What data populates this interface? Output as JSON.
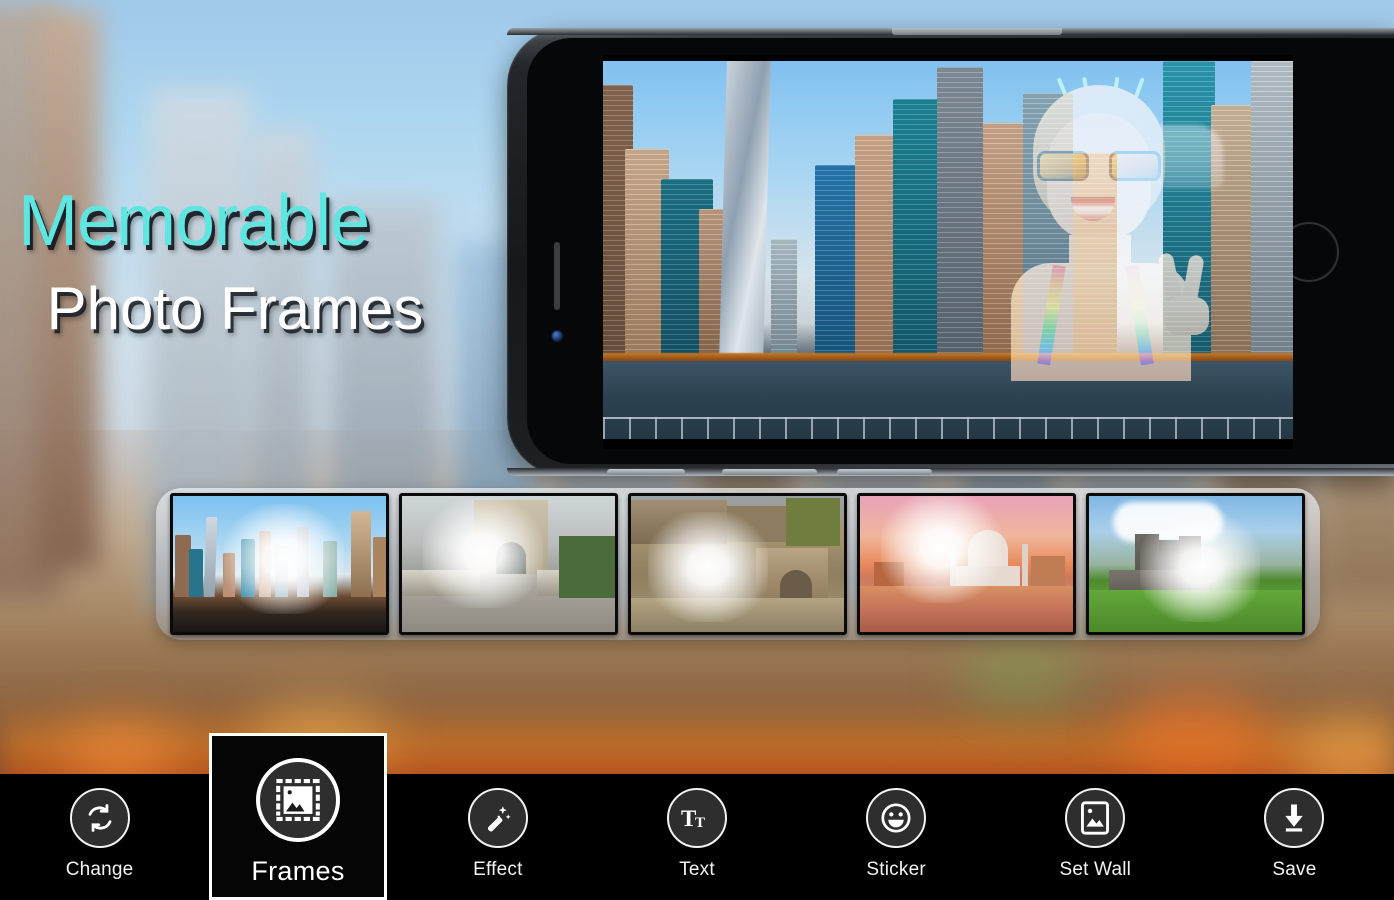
{
  "app": {
    "title_line1": "Memorable",
    "title_line2": "Photo Frames",
    "title_color_line1": "#5fe6e0",
    "title_color_line2": "#ffffff",
    "background": "blurred-city-skyline"
  },
  "preview": {
    "device": "smartphone-landscape",
    "screen_content": "dubai-marina-skyline-with-woman-portrait-overlay",
    "home_button": "home-button",
    "earpiece": "earpiece-speaker",
    "front_camera": "front-camera"
  },
  "frames_tray": {
    "selected_index": 0,
    "items": [
      {
        "id": "frame-1",
        "label": "Dubai Marina",
        "selected": true
      },
      {
        "id": "frame-2",
        "label": "Stone Bridge Gate",
        "selected": false
      },
      {
        "id": "frame-3",
        "label": "Roman Forum Ruins",
        "selected": false
      },
      {
        "id": "frame-4",
        "label": "Taj Mahal Sunset",
        "selected": false
      },
      {
        "id": "frame-5",
        "label": "Castle on Green",
        "selected": false
      }
    ]
  },
  "toolbar": {
    "items": [
      {
        "label": "Change",
        "icon": "refresh-icon",
        "selected": false
      },
      {
        "label": "Frames",
        "icon": "frames-icon",
        "selected": true
      },
      {
        "label": "Effect",
        "icon": "magic-wand-icon",
        "selected": false
      },
      {
        "label": "Text",
        "icon": "text-icon",
        "selected": false
      },
      {
        "label": "Sticker",
        "icon": "smiley-icon",
        "selected": false
      },
      {
        "label": "Set Wall",
        "icon": "wallpaper-icon",
        "selected": false
      },
      {
        "label": "Save",
        "icon": "download-icon",
        "selected": false
      }
    ],
    "background_color": "#000000",
    "icon_fill": "#2e2e2e",
    "icon_stroke": "#ffffff"
  }
}
